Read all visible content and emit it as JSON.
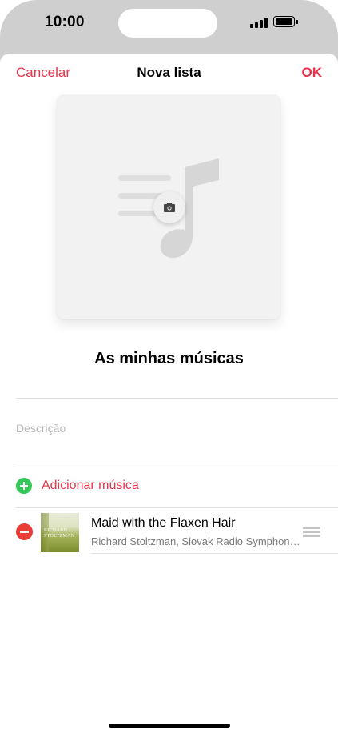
{
  "status_bar": {
    "time": "10:00"
  },
  "nav": {
    "cancel": "Cancelar",
    "title": "Nova lista",
    "ok": "OK"
  },
  "artwork": {
    "placeholder_icon": "music-note-list-icon",
    "action_icon": "camera-icon"
  },
  "playlist": {
    "name": "As minhas músicas",
    "description_placeholder": "Descrição"
  },
  "add_music": {
    "label": "Adicionar música",
    "icon": "plus-circle-icon"
  },
  "songs": [
    {
      "title": "Maid with the Flaxen Hair",
      "artist": "Richard Stoltzman, Slovak Radio Symphony Orchestra",
      "art_text_line1": "RICHARD",
      "art_text_line2": "STOLTZMAN"
    }
  ],
  "colors": {
    "accent": "#e8334a",
    "add_green": "#34c759",
    "remove_red": "#ea3c35"
  }
}
